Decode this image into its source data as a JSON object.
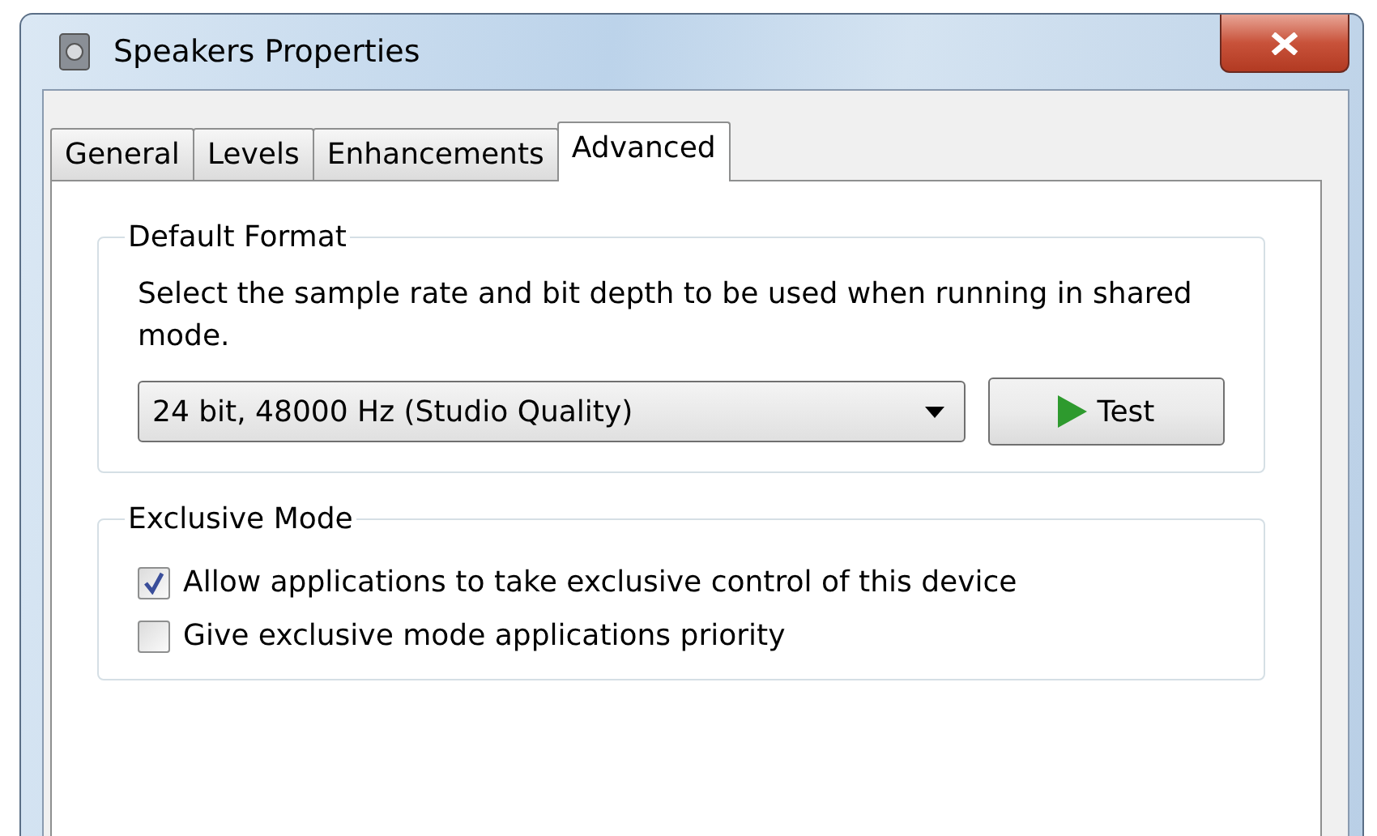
{
  "window": {
    "title": "Speakers Properties"
  },
  "tabs": [
    {
      "label": "General",
      "selected": false
    },
    {
      "label": "Levels",
      "selected": false
    },
    {
      "label": "Enhancements",
      "selected": false
    },
    {
      "label": "Advanced",
      "selected": true
    }
  ],
  "default_format": {
    "title": "Default Format",
    "description": "Select the sample rate and bit depth to be used when running in shared mode.",
    "format_select": {
      "value": "24 bit, 48000 Hz (Studio Quality)"
    },
    "test_button": "Test"
  },
  "exclusive_mode": {
    "title": "Exclusive Mode",
    "options": [
      {
        "label": "Allow applications to take exclusive control of this device",
        "checked": true
      },
      {
        "label": "Give exclusive mode applications priority",
        "checked": false
      }
    ]
  }
}
